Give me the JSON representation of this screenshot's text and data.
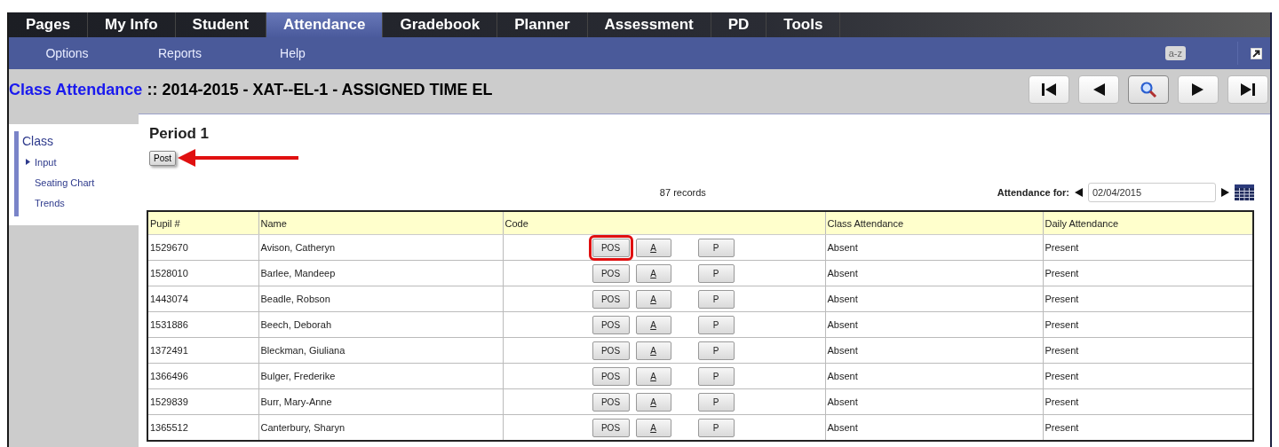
{
  "tabs": [
    {
      "label": "Pages",
      "selected": false
    },
    {
      "label": "My Info",
      "selected": false
    },
    {
      "label": "Student",
      "selected": false
    },
    {
      "label": "Attendance",
      "selected": true
    },
    {
      "label": "Gradebook",
      "selected": false
    },
    {
      "label": "Planner",
      "selected": false
    },
    {
      "label": "Assessment",
      "selected": false
    },
    {
      "label": "PD",
      "selected": false
    },
    {
      "label": "Tools",
      "selected": false
    }
  ],
  "submenu": {
    "items": [
      "Options",
      "Reports",
      "Help"
    ],
    "badge": "a-z"
  },
  "title": {
    "link": "Class Attendance",
    "text": ":: 2014-2015 - XAT--EL-1 - ASSIGNED TIME EL"
  },
  "record_nav": [
    {
      "kind": "first",
      "selected": false
    },
    {
      "kind": "prev",
      "selected": false
    },
    {
      "kind": "search",
      "selected": true
    },
    {
      "kind": "next",
      "selected": false
    },
    {
      "kind": "last",
      "selected": false
    }
  ],
  "sidebar": {
    "heading": "Class",
    "items": [
      {
        "label": "Input",
        "selected": true
      },
      {
        "label": "Seating Chart",
        "selected": false
      },
      {
        "label": "Trends",
        "selected": false
      }
    ]
  },
  "period": {
    "heading": "Period 1",
    "post_button": {
      "label": "Post",
      "annotated": true
    },
    "records": "87 records",
    "attendance_for": {
      "label": "Attendance for:",
      "date": "02/04/2015"
    }
  },
  "table": {
    "columns": [
      "Pupil #",
      "Name",
      "Code",
      "Class Attendance",
      "Daily Attendance"
    ],
    "rows": [
      {
        "pupil": "1529670",
        "name": "Avison, Catheryn",
        "codes": [
          {
            "label": "POS",
            "highlighted": true
          },
          {
            "label": "A",
            "highlighted": false
          },
          {
            "label": "P",
            "highlighted": false
          }
        ],
        "class_attendance": "Absent",
        "daily_attendance": "Present"
      },
      {
        "pupil": "1528010",
        "name": "Barlee, Mandeep",
        "codes": [
          {
            "label": "POS",
            "highlighted": false
          },
          {
            "label": "A",
            "highlighted": false
          },
          {
            "label": "P",
            "highlighted": false
          }
        ],
        "class_attendance": "Absent",
        "daily_attendance": "Present"
      },
      {
        "pupil": "1443074",
        "name": "Beadle, Robson",
        "codes": [
          {
            "label": "POS",
            "highlighted": false
          },
          {
            "label": "A",
            "highlighted": false
          },
          {
            "label": "P",
            "highlighted": false
          }
        ],
        "class_attendance": "Absent",
        "daily_attendance": "Present"
      },
      {
        "pupil": "1531886",
        "name": "Beech, Deborah",
        "codes": [
          {
            "label": "POS",
            "highlighted": false
          },
          {
            "label": "A",
            "highlighted": false
          },
          {
            "label": "P",
            "highlighted": false
          }
        ],
        "class_attendance": "Absent",
        "daily_attendance": "Present"
      },
      {
        "pupil": "1372491",
        "name": "Bleckman, Giuliana",
        "codes": [
          {
            "label": "POS",
            "highlighted": false
          },
          {
            "label": "A",
            "highlighted": false
          },
          {
            "label": "P",
            "highlighted": false
          }
        ],
        "class_attendance": "Absent",
        "daily_attendance": "Present"
      },
      {
        "pupil": "1366496",
        "name": "Bulger, Frederike",
        "codes": [
          {
            "label": "POS",
            "highlighted": false
          },
          {
            "label": "A",
            "highlighted": false
          },
          {
            "label": "P",
            "highlighted": false
          }
        ],
        "class_attendance": "Absent",
        "daily_attendance": "Present"
      },
      {
        "pupil": "1529839",
        "name": "Burr, Mary-Anne",
        "codes": [
          {
            "label": "POS",
            "highlighted": false
          },
          {
            "label": "A",
            "highlighted": false
          },
          {
            "label": "P",
            "highlighted": false
          }
        ],
        "class_attendance": "Absent",
        "daily_attendance": "Present"
      },
      {
        "pupil": "1365512",
        "name": "Canterbury, Sharyn",
        "codes": [
          {
            "label": "POS",
            "highlighted": false
          },
          {
            "label": "A",
            "highlighted": false
          },
          {
            "label": "P",
            "highlighted": false
          }
        ],
        "class_attendance": "Absent",
        "daily_attendance": "Present"
      }
    ]
  }
}
